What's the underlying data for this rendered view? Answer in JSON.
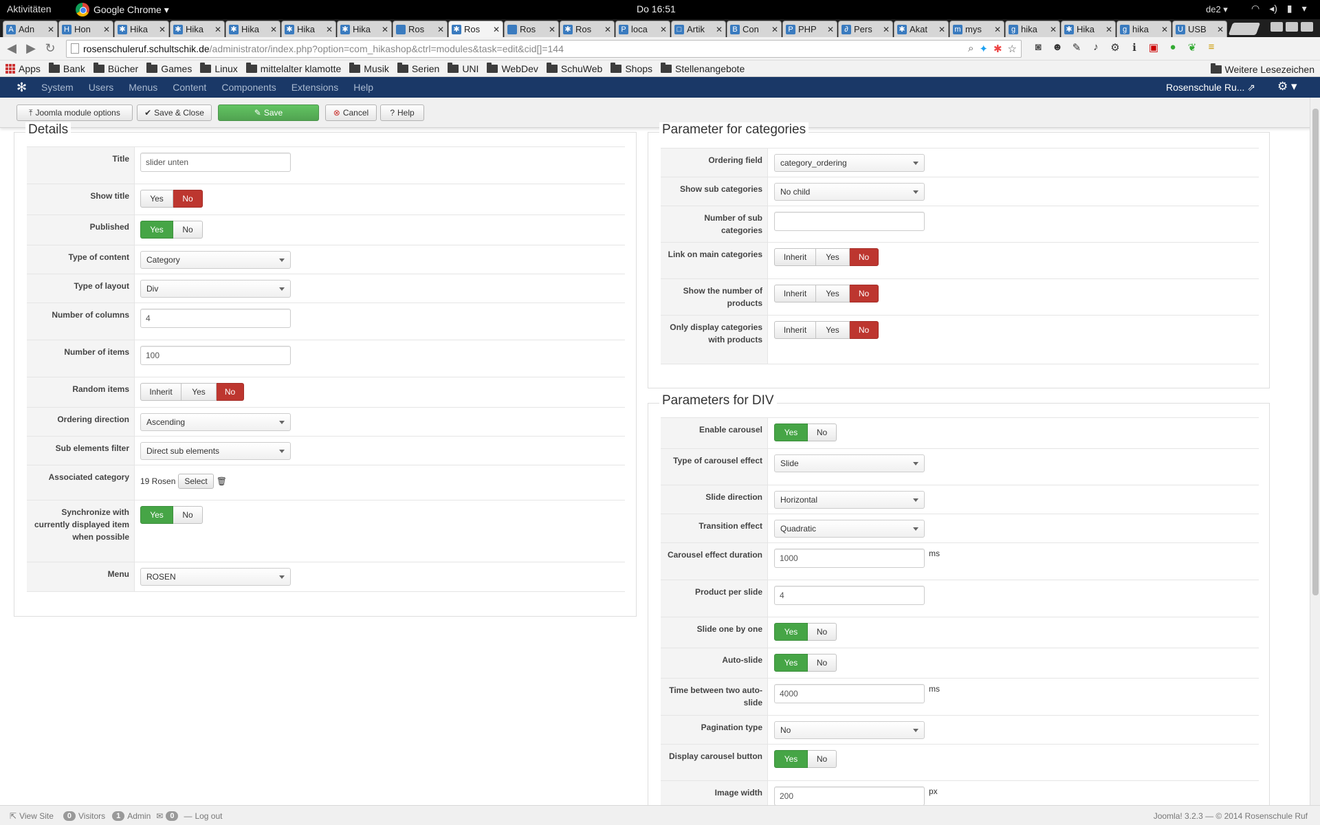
{
  "os": {
    "activities": "Aktivitäten",
    "app_name": "Google Chrome ▾",
    "clock": "Do 16:51",
    "keyboard": "de2 ▾"
  },
  "browser": {
    "tabs": [
      {
        "label": "Adn",
        "icon": "A"
      },
      {
        "label": "Hon",
        "icon": "H"
      },
      {
        "label": "Hika",
        "icon": "✱"
      },
      {
        "label": "Hika",
        "icon": "✱"
      },
      {
        "label": "Hika",
        "icon": "✱"
      },
      {
        "label": "Hika",
        "icon": "✱"
      },
      {
        "label": "Hika",
        "icon": "✱"
      },
      {
        "label": "Ros",
        "icon": ""
      },
      {
        "label": "Ros",
        "icon": "✱"
      },
      {
        "label": "Ros",
        "icon": ""
      },
      {
        "label": "Ros",
        "icon": "✱"
      },
      {
        "label": "loca",
        "icon": "P"
      },
      {
        "label": "Artik",
        "icon": "□"
      },
      {
        "label": "Con",
        "icon": "B"
      },
      {
        "label": "PHP",
        "icon": "P"
      },
      {
        "label": "Pers",
        "icon": "∂"
      },
      {
        "label": "Akat",
        "icon": "✱"
      },
      {
        "label": "mys",
        "icon": "m"
      },
      {
        "label": "hika",
        "icon": "g"
      },
      {
        "label": "Hika",
        "icon": "✱"
      },
      {
        "label": "hika",
        "icon": "g"
      },
      {
        "label": "USB",
        "icon": "U"
      }
    ],
    "active_tab_index": 8,
    "url_host": "rosenschuleruf.schultschik.de",
    "url_path": "/administrator/index.php?option=com_hikashop&ctrl=modules&task=edit&cid[]=144",
    "bookmarks": [
      "Apps",
      "Bank",
      "Bücher",
      "Games",
      "Linux",
      "mittelalter klamotte",
      "Musik",
      "Serien",
      "UNI",
      "WebDev",
      "SchuWeb",
      "Shops",
      "Stellenangebote"
    ],
    "bookmarks_right": "Weitere Lesezeichen"
  },
  "admin": {
    "menu": [
      "System",
      "Users",
      "Menus",
      "Content",
      "Components",
      "Extensions",
      "Help"
    ],
    "site_name": "Rosenschule Ru...",
    "toolbar": {
      "module_options": "Joomla module options",
      "save_close": "Save & Close",
      "save": "Save",
      "cancel": "Cancel",
      "help": "Help"
    }
  },
  "details": {
    "legend": "Details",
    "title_label": "Title",
    "title_value": "slider unten",
    "show_title_label": "Show title",
    "published_label": "Published",
    "type_content_label": "Type of content",
    "type_content_value": "Category",
    "type_layout_label": "Type of layout",
    "type_layout_value": "Div",
    "num_columns_label": "Number of columns",
    "num_columns_value": "4",
    "num_items_label": "Number of items",
    "num_items_value": "100",
    "random_items_label": "Random items",
    "ordering_dir_label": "Ordering direction",
    "ordering_dir_value": "Ascending",
    "sub_filter_label": "Sub elements filter",
    "sub_filter_value": "Direct sub elements",
    "assoc_cat_label": "Associated category",
    "assoc_cat_value": "19 Rosen",
    "select_label": "Select",
    "sync_label": "Synchronize with currently displayed item when possible",
    "menu_label": "Menu",
    "menu_value": "ROSEN"
  },
  "toggles": {
    "yes": "Yes",
    "no": "No",
    "inherit": "Inherit"
  },
  "categories": {
    "legend": "Parameter for categories",
    "ordering_field_label": "Ordering field",
    "ordering_field_value": "category_ordering",
    "show_sub_label": "Show sub categories",
    "show_sub_value": "No child",
    "num_sub_label": "Number of sub categories",
    "num_sub_value": "",
    "link_main_label": "Link on main categories",
    "show_num_label": "Show the number of products",
    "only_display_label": "Only display categories with products"
  },
  "div": {
    "legend": "Parameters for DIV",
    "enable_carousel_label": "Enable carousel",
    "carousel_effect_label": "Type of carousel effect",
    "carousel_effect_value": "Slide",
    "slide_dir_label": "Slide direction",
    "slide_dir_value": "Horizontal",
    "transition_label": "Transition effect",
    "transition_value": "Quadratic",
    "effect_duration_label": "Carousel effect duration",
    "effect_duration_value": "1000",
    "unit_ms": "ms",
    "per_slide_label": "Product per slide",
    "per_slide_value": "4",
    "one_by_one_label": "Slide one by one",
    "auto_slide_label": "Auto-slide",
    "time_between_label": "Time between two auto-slide",
    "time_between_value": "4000",
    "pagination_label": "Pagination type",
    "pagination_value": "No",
    "carousel_button_label": "Display carousel button",
    "image_width_label": "Image width",
    "image_width_value": "200",
    "unit_px": "px"
  },
  "status": {
    "view_site": "View Site",
    "visitors_count": "0",
    "visitors": "Visitors",
    "admin_count": "1",
    "admin": "Admin",
    "msg_count": "0",
    "logout": "Log out",
    "footer": "Joomla! 3.2.3 — © 2014 Rosenschule Ruf"
  }
}
